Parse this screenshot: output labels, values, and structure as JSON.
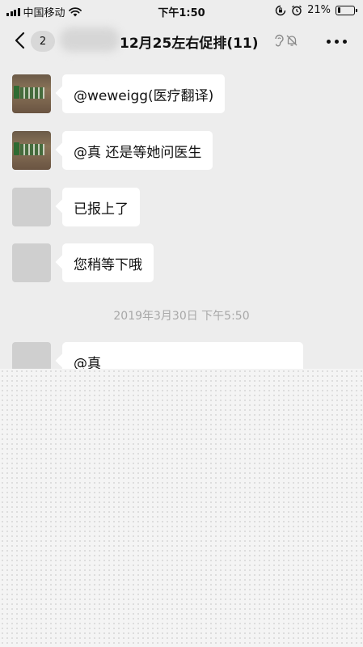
{
  "status_bar": {
    "carrier": "中国移动",
    "time": "下午1:50",
    "battery_text": "21%",
    "battery_level": 0.21,
    "icons": [
      "signal-icon",
      "wifi-icon",
      "rotation-lock-icon",
      "alarm-icon",
      "battery-icon"
    ]
  },
  "nav": {
    "back_icon": "chevron-left-icon",
    "unread_count": "2",
    "title": "12月25左右促排(11)",
    "icons": [
      "ear-icon",
      "mute-bell-icon",
      "more-icon"
    ]
  },
  "messages": [
    {
      "avatar": "photo",
      "text": "@weweigg(医疗翻译)"
    },
    {
      "avatar": "photo",
      "text": "@真 还是等她问医生"
    },
    {
      "avatar": "gray",
      "text": "已报上了"
    },
    {
      "avatar": "gray",
      "text": "您稍等下哦"
    },
    {
      "avatar": "gray",
      "text": "@真"
    }
  ],
  "timestamp": "2019年3月30日 下午5:50"
}
